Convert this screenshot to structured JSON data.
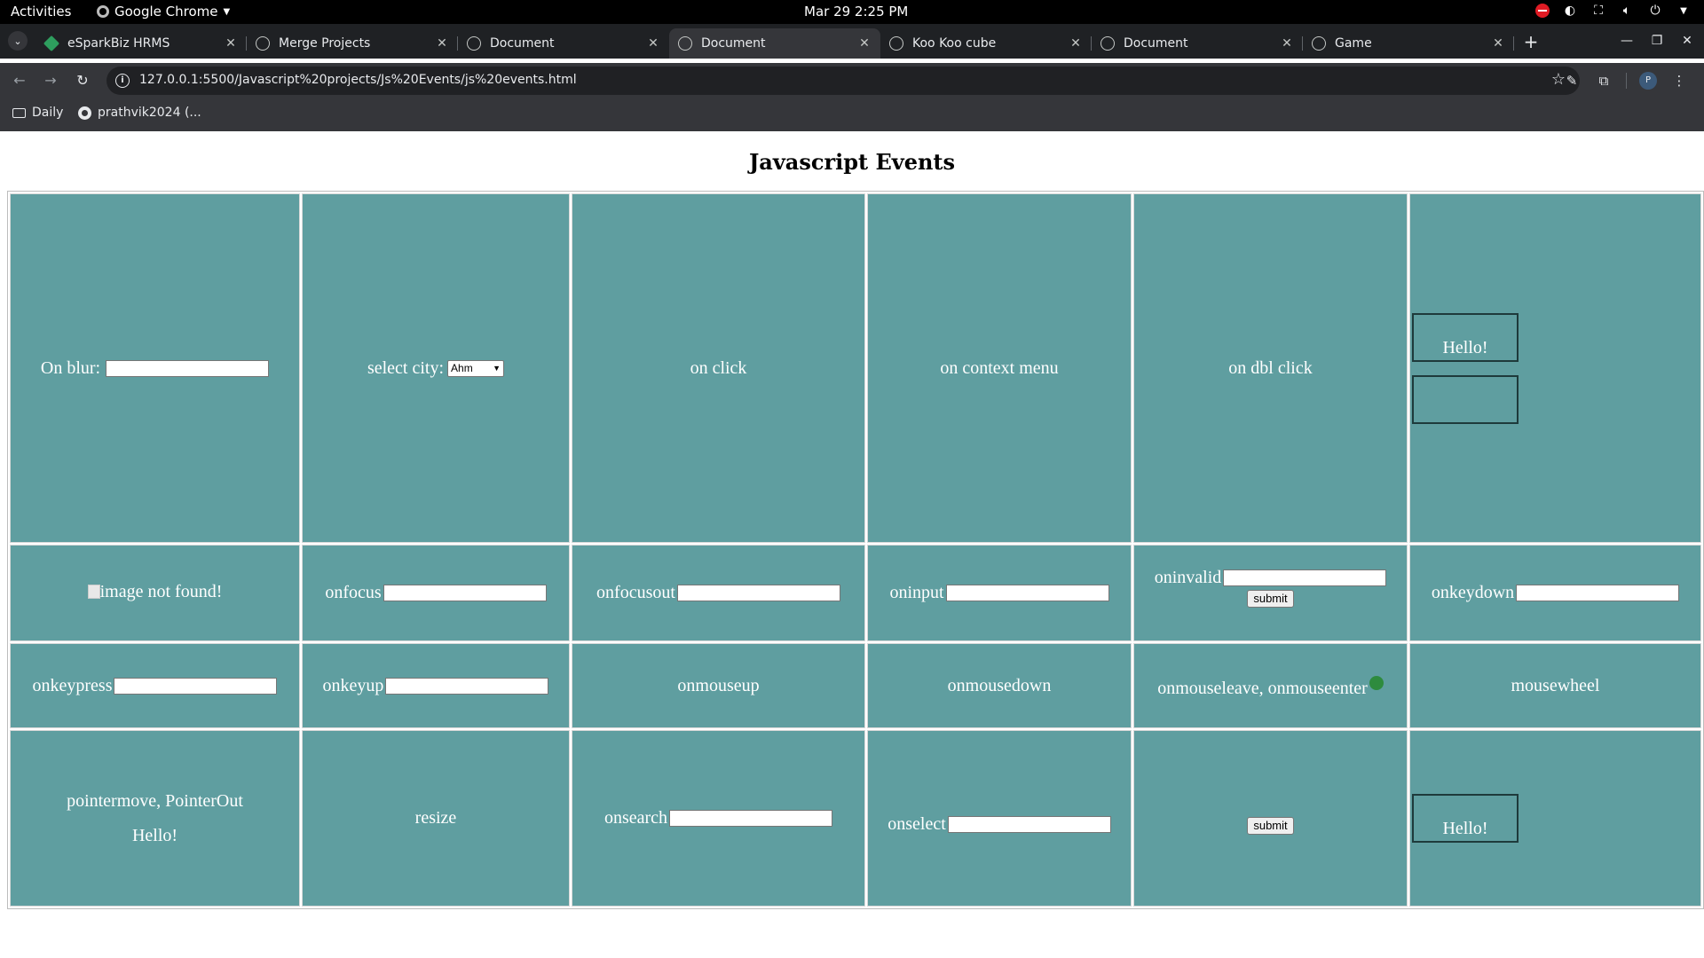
{
  "topbar": {
    "activities": "Activities",
    "app_name": "Google Chrome",
    "clock": "Mar 29  2:25 PM"
  },
  "tabs": [
    {
      "title": "eSparkBiz HRMS",
      "active": false
    },
    {
      "title": "Merge Projects",
      "active": false
    },
    {
      "title": "Document",
      "active": false
    },
    {
      "title": "Document",
      "active": true
    },
    {
      "title": "Koo Koo cube",
      "active": false
    },
    {
      "title": "Document",
      "active": false
    },
    {
      "title": "Game",
      "active": false
    }
  ],
  "toolbar": {
    "url": "127.0.0.1:5500/Javascript%20projects/Js%20Events/js%20events.html"
  },
  "bookmarks": [
    {
      "label": "Daily",
      "icon": "folder-icon"
    },
    {
      "label": "prathvik2024 (...",
      "icon": "github-icon"
    }
  ],
  "page": {
    "title": "Javascript Events",
    "rows": [
      {
        "c1": {
          "label": "On blur:",
          "input_value": ""
        },
        "c2": {
          "label": "select city:",
          "selected": "Ahm"
        },
        "c3": {
          "label": "on click"
        },
        "c4": {
          "label": "on context menu"
        },
        "c5": {
          "label": "on dbl click"
        },
        "c6": {
          "box1": "Hello!",
          "box2": ""
        }
      },
      {
        "c1": {
          "alt": "image not found!"
        },
        "c2": {
          "label": "onfocus",
          "input_value": ""
        },
        "c3": {
          "label": "onfocusout",
          "input_value": ""
        },
        "c4": {
          "label": "oninput",
          "input_value": ""
        },
        "c5": {
          "label": "oninvalid",
          "input_value": "",
          "button": "submit"
        },
        "c6": {
          "label": "onkeydown",
          "input_value": ""
        }
      },
      {
        "c1": {
          "label": "onkeypress",
          "input_value": ""
        },
        "c2": {
          "label": "onkeyup",
          "input_value": ""
        },
        "c3": {
          "label": "onmouseup"
        },
        "c4": {
          "label": "onmousedown"
        },
        "c5": {
          "label": "onmouseleave, onmouseenter"
        },
        "c6": {
          "label": "mousewheel"
        }
      },
      {
        "c1": {
          "label": "pointermove, PointerOut",
          "sub": "Hello!"
        },
        "c2": {
          "label": "resize"
        },
        "c3": {
          "label": "onsearch",
          "input_value": ""
        },
        "c4": {
          "label": "onselect",
          "input_value": ""
        },
        "c5": {
          "button": "submit"
        },
        "c6": {
          "box1": "Hello!"
        }
      }
    ]
  },
  "colors": {
    "cell_bg": "#5f9ea0",
    "tab_strip": "#1f2124",
    "toolbar": "#35363a"
  }
}
